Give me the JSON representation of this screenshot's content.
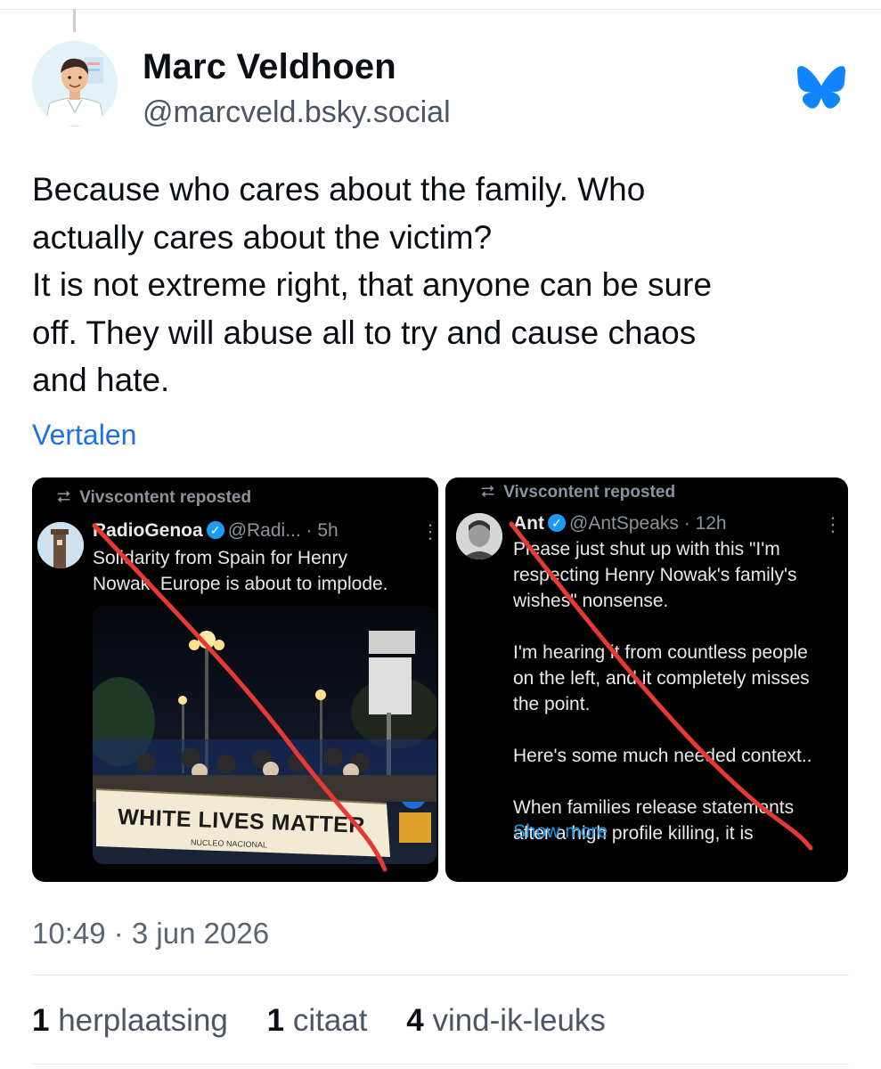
{
  "author": {
    "name": "Marc Veldhoen",
    "handle": "@marcveld.bsky.social"
  },
  "post": {
    "text": "Because who cares about the family. Who\nactually cares about the victim?\nIt is not extreme right, that anyone can be sure\noff. They will abuse all to try and cause chaos\nand hate.",
    "translate_label": "Vertalen"
  },
  "embeds": {
    "left": {
      "repost_label": "Vivscontent reposted",
      "name": "RadioGenoa",
      "handle_time": "@Radi... · 5h",
      "text": "Solidarity from Spain for Henry\nNowak. Europe is about to implode.",
      "banner_text": "WHITE LIVES MATTER",
      "banner_subtext": "NUCLEO NACIONAL"
    },
    "right": {
      "repost_label": "Vivscontent reposted",
      "name": "Ant",
      "handle_time": "@AntSpeaks · 12h",
      "text": "Please just shut up with this \"I'm\nrespecting Henry Nowak's family's\nwishes\" nonsense.\n\nI'm hearing it from countless people\non the left, and it completely misses\nthe point.\n\nHere's some much needed context..\n\nWhen families release statements\nafter a high profile killing, it is",
      "show_more": "Show\nmore"
    }
  },
  "timestamp": "10:49 · 3 jun 2026",
  "stats": {
    "reposts_count": "1",
    "reposts_label": "herplaatsing",
    "quotes_count": "1",
    "quotes_label": "citaat",
    "likes_count": "4",
    "likes_label": "vind-ik-leuks"
  },
  "icons": {
    "app_logo": "bluesky-butterfly-icon",
    "repost": "repost-icon",
    "verified": "verified-badge-icon"
  },
  "colors": {
    "bluesky_blue": "#1185fe",
    "link_blue": "#1f6feb",
    "annotation_red": "#e53935"
  }
}
